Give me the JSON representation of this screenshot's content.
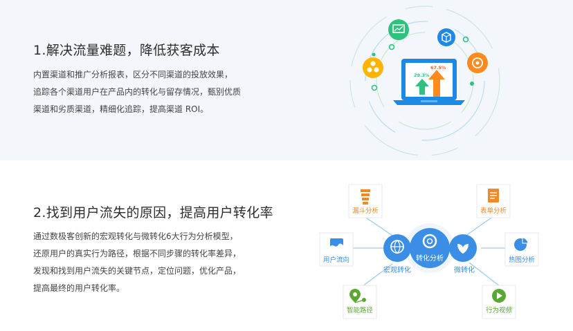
{
  "section1": {
    "title": "1.解决流量难题，降低获客成本",
    "body": "内置渠道和推广分析报表，区分不同渠道的投放效果， 追踪各个渠道用户在产品内的转化与留存情况，甄别优质渠道和劣质渠道，精细化追踪，提高渠道 ROI。",
    "illustration": {
      "left_value": "29.3%",
      "right_value": "67.5%",
      "colors": {
        "green": "#2ec27e",
        "orange": "#ff8a1f",
        "blue": "#1e88e5",
        "yellow": "#ffb400"
      }
    }
  },
  "section2": {
    "title": "2.找到用户流失的原因，提高用户转化率",
    "body": "通过数极客创新的宏观转化与微转化6大行为分析模型，还原用户的真实行为路径，根据不同步骤的转化率差异，发现和找到用户流失的关键节点，定位问题，优化产品，提高最终的用户转化率。",
    "diagram": {
      "center": "转化分析",
      "macro": "宏观转化",
      "micro": "微转化",
      "funnel": "漏斗分析",
      "form": "表单分析",
      "flow": "用户流向",
      "heatmap": "热图分析",
      "path": "智能路径",
      "video": "行为视频",
      "colors": {
        "blue": "#3a8ee6",
        "orange": "#f08a24",
        "green": "#5aa832"
      }
    }
  }
}
